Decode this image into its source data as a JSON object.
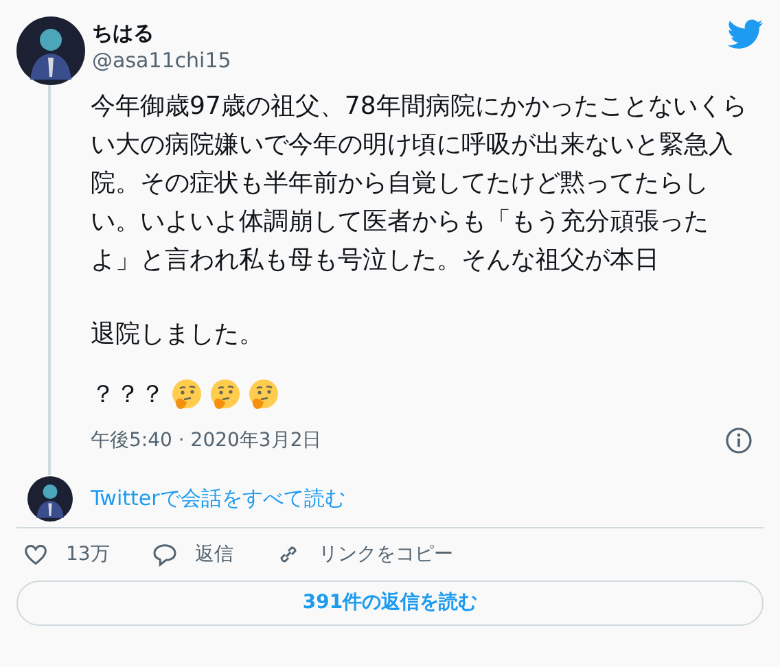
{
  "author": {
    "name": "ちはる",
    "handle": "@asa11chi15"
  },
  "paragraphs": [
    "今年御歳97歳の祖父、78年間病院にかかったことないくらい大の病院嫌いで今年の明け頃に呼吸が出来ないと緊急入院。その症状も半年前から自覚してたけど黙ってたらしい。いよいよ体調崩して医者からも「もう充分頑張ったよ」と言われ私も母も号泣した。そんな祖父が本日",
    "退院しました。"
  ],
  "ending": {
    "text": "？？？"
  },
  "timestamp": "午後5:40 · 2020年3月2日",
  "conversation_link": "Twitterで会話をすべて読む",
  "actions": [
    {
      "kind": "like",
      "label": "13万"
    },
    {
      "kind": "reply",
      "label": "返信"
    },
    {
      "kind": "copy",
      "label": "リンクをコピー"
    }
  ],
  "replies_button": "391件の返信を読む"
}
